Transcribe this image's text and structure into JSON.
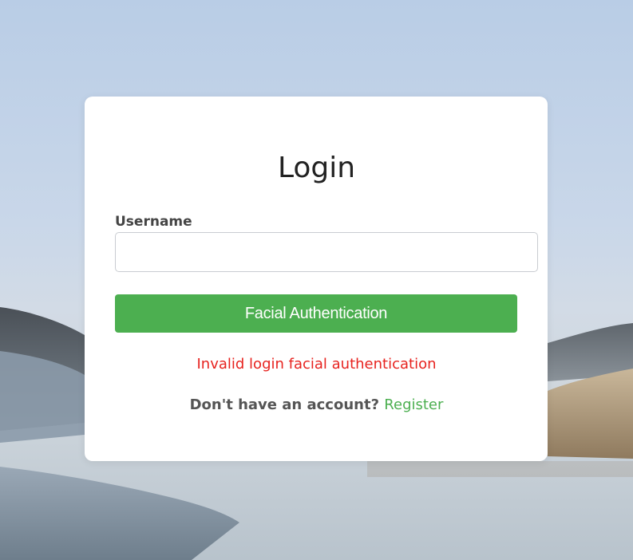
{
  "login": {
    "title": "Login",
    "username_label": "Username",
    "username_value": "",
    "username_placeholder": "",
    "submit_label": "Facial Authentication",
    "error_message": "Invalid login facial authentication",
    "register_prompt": "Don't have an account?",
    "register_link": "Register"
  },
  "colors": {
    "accent": "#4caf50",
    "error": "#e7231f",
    "card": "#ffffff"
  }
}
